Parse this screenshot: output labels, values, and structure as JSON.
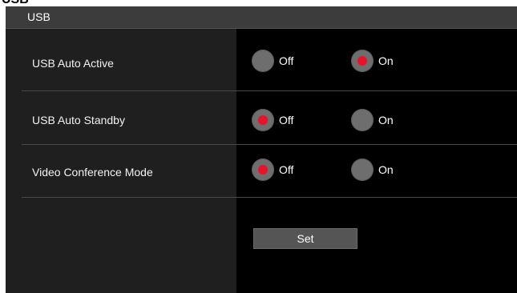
{
  "section_title": "USB",
  "top_cut_text": "USB",
  "rows": [
    {
      "label": "USB Auto Active",
      "options": [
        "Off",
        "On"
      ],
      "selected": "On"
    },
    {
      "label": "USB Auto Standby",
      "options": [
        "Off",
        "On"
      ],
      "selected": "Off"
    },
    {
      "label": "Video Conference Mode",
      "options": [
        "Off",
        "On"
      ],
      "selected": "Off"
    }
  ],
  "set_button_label": "Set",
  "colors": {
    "panel_bg": "#1a1a1a",
    "header_bg": "#3c3c3c",
    "value_bg": "#000000",
    "radio_off": "#6e6e6e",
    "radio_selected_dot": "#e8122b",
    "button_bg": "#555555"
  }
}
